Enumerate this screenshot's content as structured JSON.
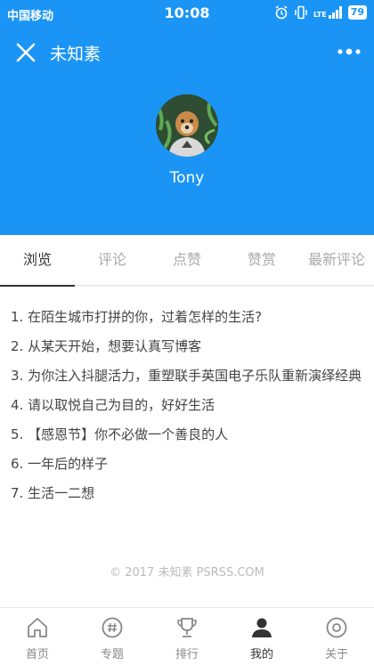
{
  "status_bar": {
    "carrier": "中国移动",
    "time": "10:08",
    "lte": "LTE",
    "battery": "79"
  },
  "header": {
    "title": "未知素",
    "username": "Tony"
  },
  "tabs": [
    {
      "label": "浏览",
      "active": true
    },
    {
      "label": "评论",
      "active": false
    },
    {
      "label": "点赞",
      "active": false
    },
    {
      "label": "赞赏",
      "active": false
    },
    {
      "label": "最新评论",
      "active": false
    }
  ],
  "articles": [
    "1. 在陌生城市打拼的你，过着怎样的生活?",
    "2. 从某天开始，想要认真写博客",
    "3. 为你注入抖腿活力，重塑联手英国电子乐队重新演绎经典",
    "4. 请以取悦自己为目的，好好生活",
    "5. 【感恩节】你不必做一个善良的人",
    "6. 一年后的样子",
    "7. 生活一二想"
  ],
  "footer": "© 2017 未知素 PSRSS.COM",
  "tabbar": [
    {
      "label": "首页",
      "icon": "home-icon"
    },
    {
      "label": "专题",
      "icon": "hashtag-icon"
    },
    {
      "label": "排行",
      "icon": "trophy-icon"
    },
    {
      "label": "我的",
      "icon": "user-icon",
      "active": true
    },
    {
      "label": "关于",
      "icon": "about-icon"
    }
  ],
  "colors": {
    "primary": "#1b95f5",
    "active_text": "#333333",
    "inactive_text": "#aaaaaa"
  }
}
